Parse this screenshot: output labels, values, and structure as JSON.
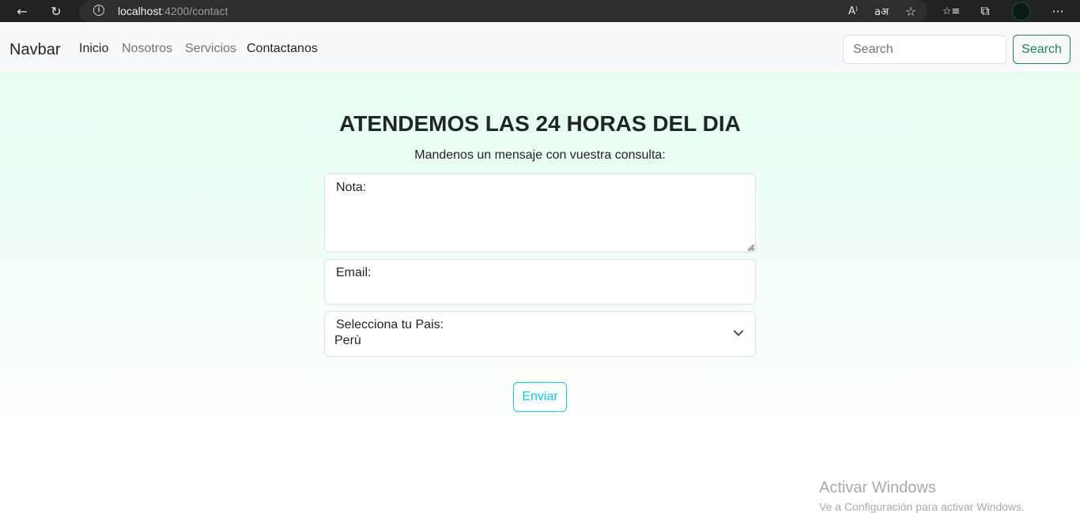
{
  "browser": {
    "url_host": "localhost",
    "url_rest": ":4200/contact",
    "back_glyph": "←",
    "refresh_glyph": "↻",
    "info_glyph": "i",
    "read_aloud_glyph": "A⁾",
    "translate_glyph": "aअ",
    "favorite_add_glyph": "☆",
    "favorites_glyph": "☆≡",
    "collections_glyph": "⧉",
    "more_glyph": "···",
    "icons": [
      "back-arrow-icon",
      "refresh-icon",
      "site-info-icon",
      "read-aloud-icon",
      "translate-icon",
      "add-favorite-icon",
      "favorites-icon",
      "collections-icon",
      "profile-avatar",
      "more-icon"
    ]
  },
  "navbar": {
    "brand": "Navbar",
    "links": [
      {
        "label": "Inicio",
        "active": true
      },
      {
        "label": "Nosotros",
        "active": false
      },
      {
        "label": "Servicios",
        "active": false
      },
      {
        "label": "Contactanos",
        "active": false
      }
    ],
    "search_placeholder": "Search",
    "search_button": "Search"
  },
  "main": {
    "title": "ATENDEMOS LAS 24 HORAS DEL DIA",
    "subtitle": "Mandenos un mensaje con vuestra consulta:",
    "note_label": "Nota:",
    "note_value": "",
    "email_label": "Email:",
    "email_value": "",
    "country_label": "Selecciona tu Pais:",
    "country_selected": "Perù",
    "submit_label": "Enviar"
  },
  "watermark": {
    "line1": "Activar Windows",
    "line2": "Ve a Configuración para activar Windows."
  },
  "colors": {
    "success": "#198754",
    "info": "#0dcaf0",
    "page_bg_top": "#e5fdef"
  }
}
